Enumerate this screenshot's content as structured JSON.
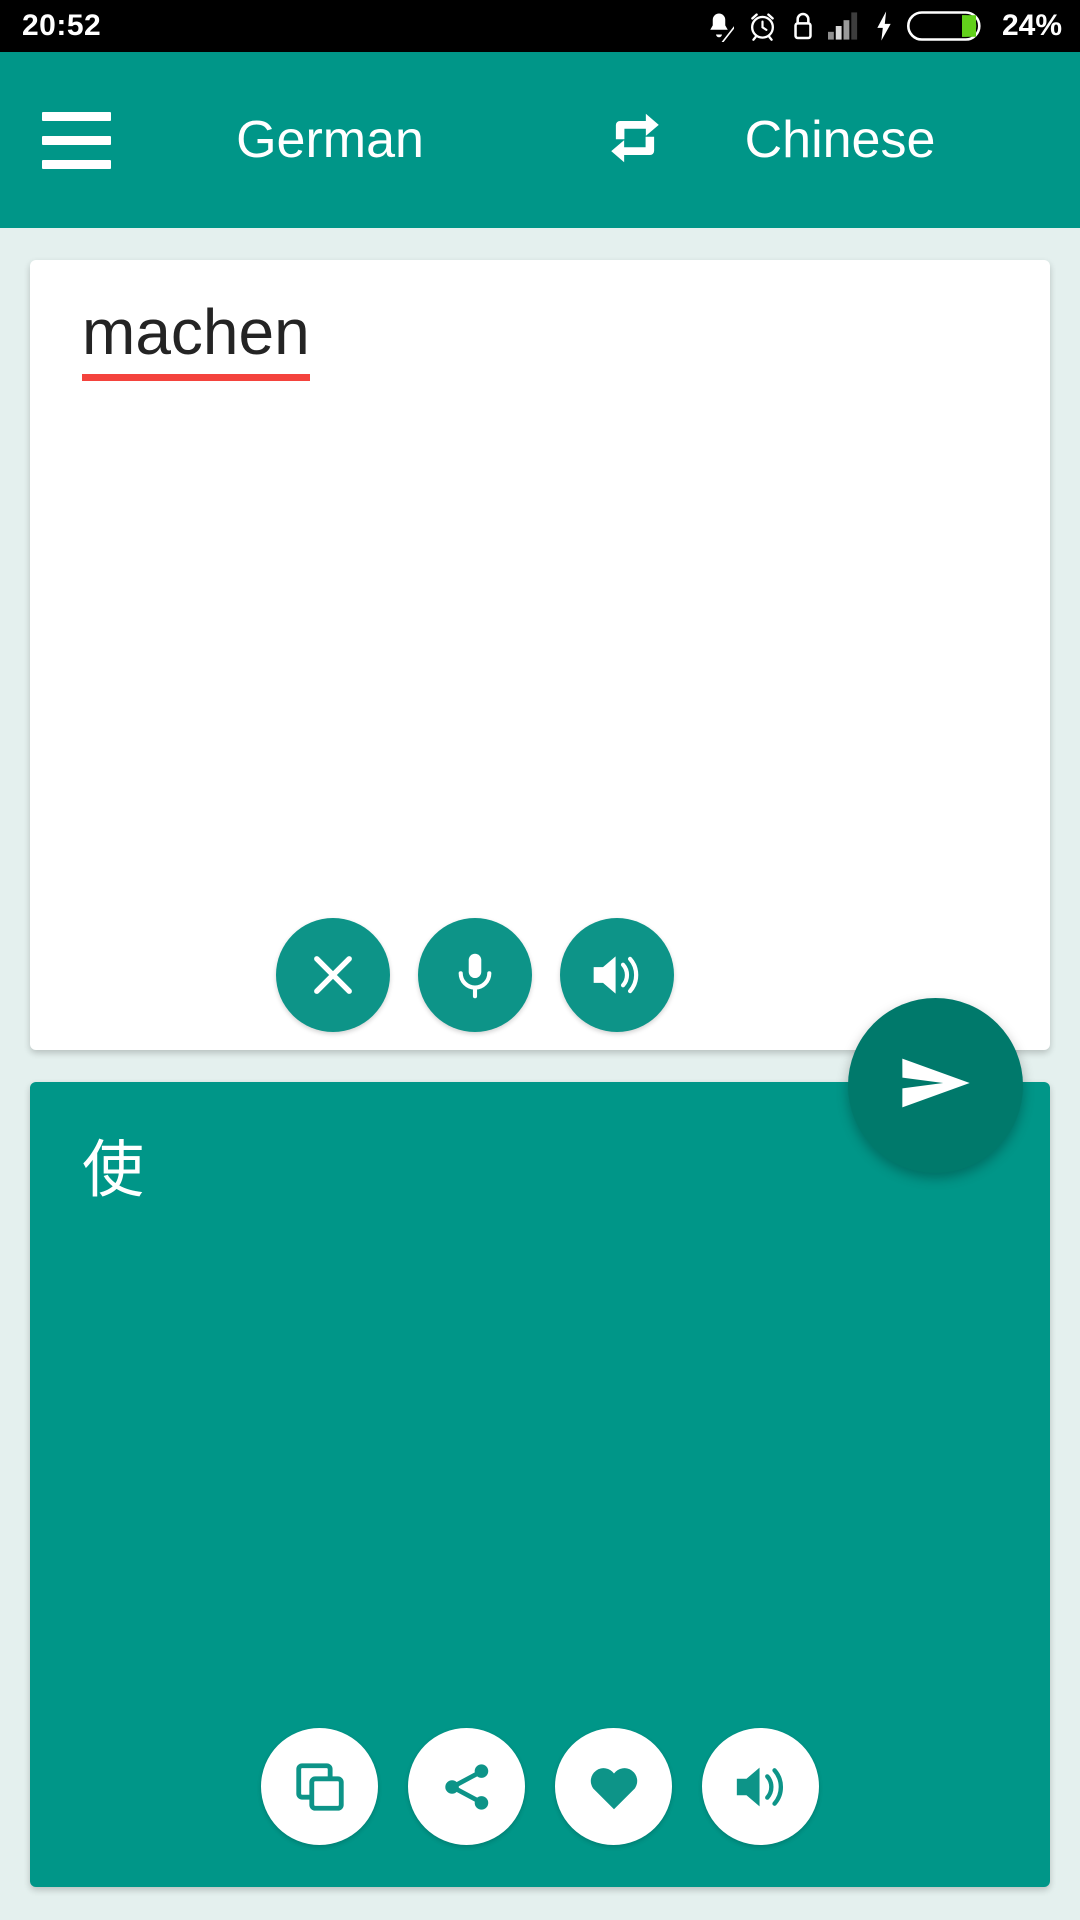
{
  "status_bar": {
    "time": "20:52",
    "battery_percent": "24%",
    "icons": [
      "bell-muted-icon",
      "alarm-clock-icon",
      "lock-icon",
      "signal-bars-icon",
      "charging-bolt-icon",
      "battery-icon"
    ]
  },
  "header": {
    "menu_label": "menu",
    "source_language": "German",
    "target_language": "Chinese",
    "swap_icon": "repeat-swap-icon",
    "background_color": "#009688"
  },
  "source_card": {
    "text": "machen",
    "spellcheck_underline_color": "#f4433d",
    "background_color": "#ffffff",
    "actions": [
      {
        "name": "clear-button",
        "icon": "close-icon",
        "label": "Clear"
      },
      {
        "name": "mic-button",
        "icon": "microphone-icon",
        "label": "Speak"
      },
      {
        "name": "speak-source-button",
        "icon": "speaker-icon",
        "label": "Listen"
      }
    ]
  },
  "send_button": {
    "name": "translate-send-button",
    "icon": "send-icon",
    "label": "Translate",
    "color": "#00796b"
  },
  "target_card": {
    "text": "使",
    "background_color": "#009688",
    "actions": [
      {
        "name": "copy-button",
        "icon": "copy-icon",
        "label": "Copy"
      },
      {
        "name": "share-button",
        "icon": "share-icon",
        "label": "Share"
      },
      {
        "name": "favorite-button",
        "icon": "heart-icon",
        "label": "Favorite"
      },
      {
        "name": "speak-target-button",
        "icon": "speaker-icon",
        "label": "Listen"
      }
    ]
  },
  "theme": {
    "primary": "#009688",
    "primary_dark": "#00796b",
    "background": "#e4f0ee",
    "accent_red": "#f4433d"
  }
}
